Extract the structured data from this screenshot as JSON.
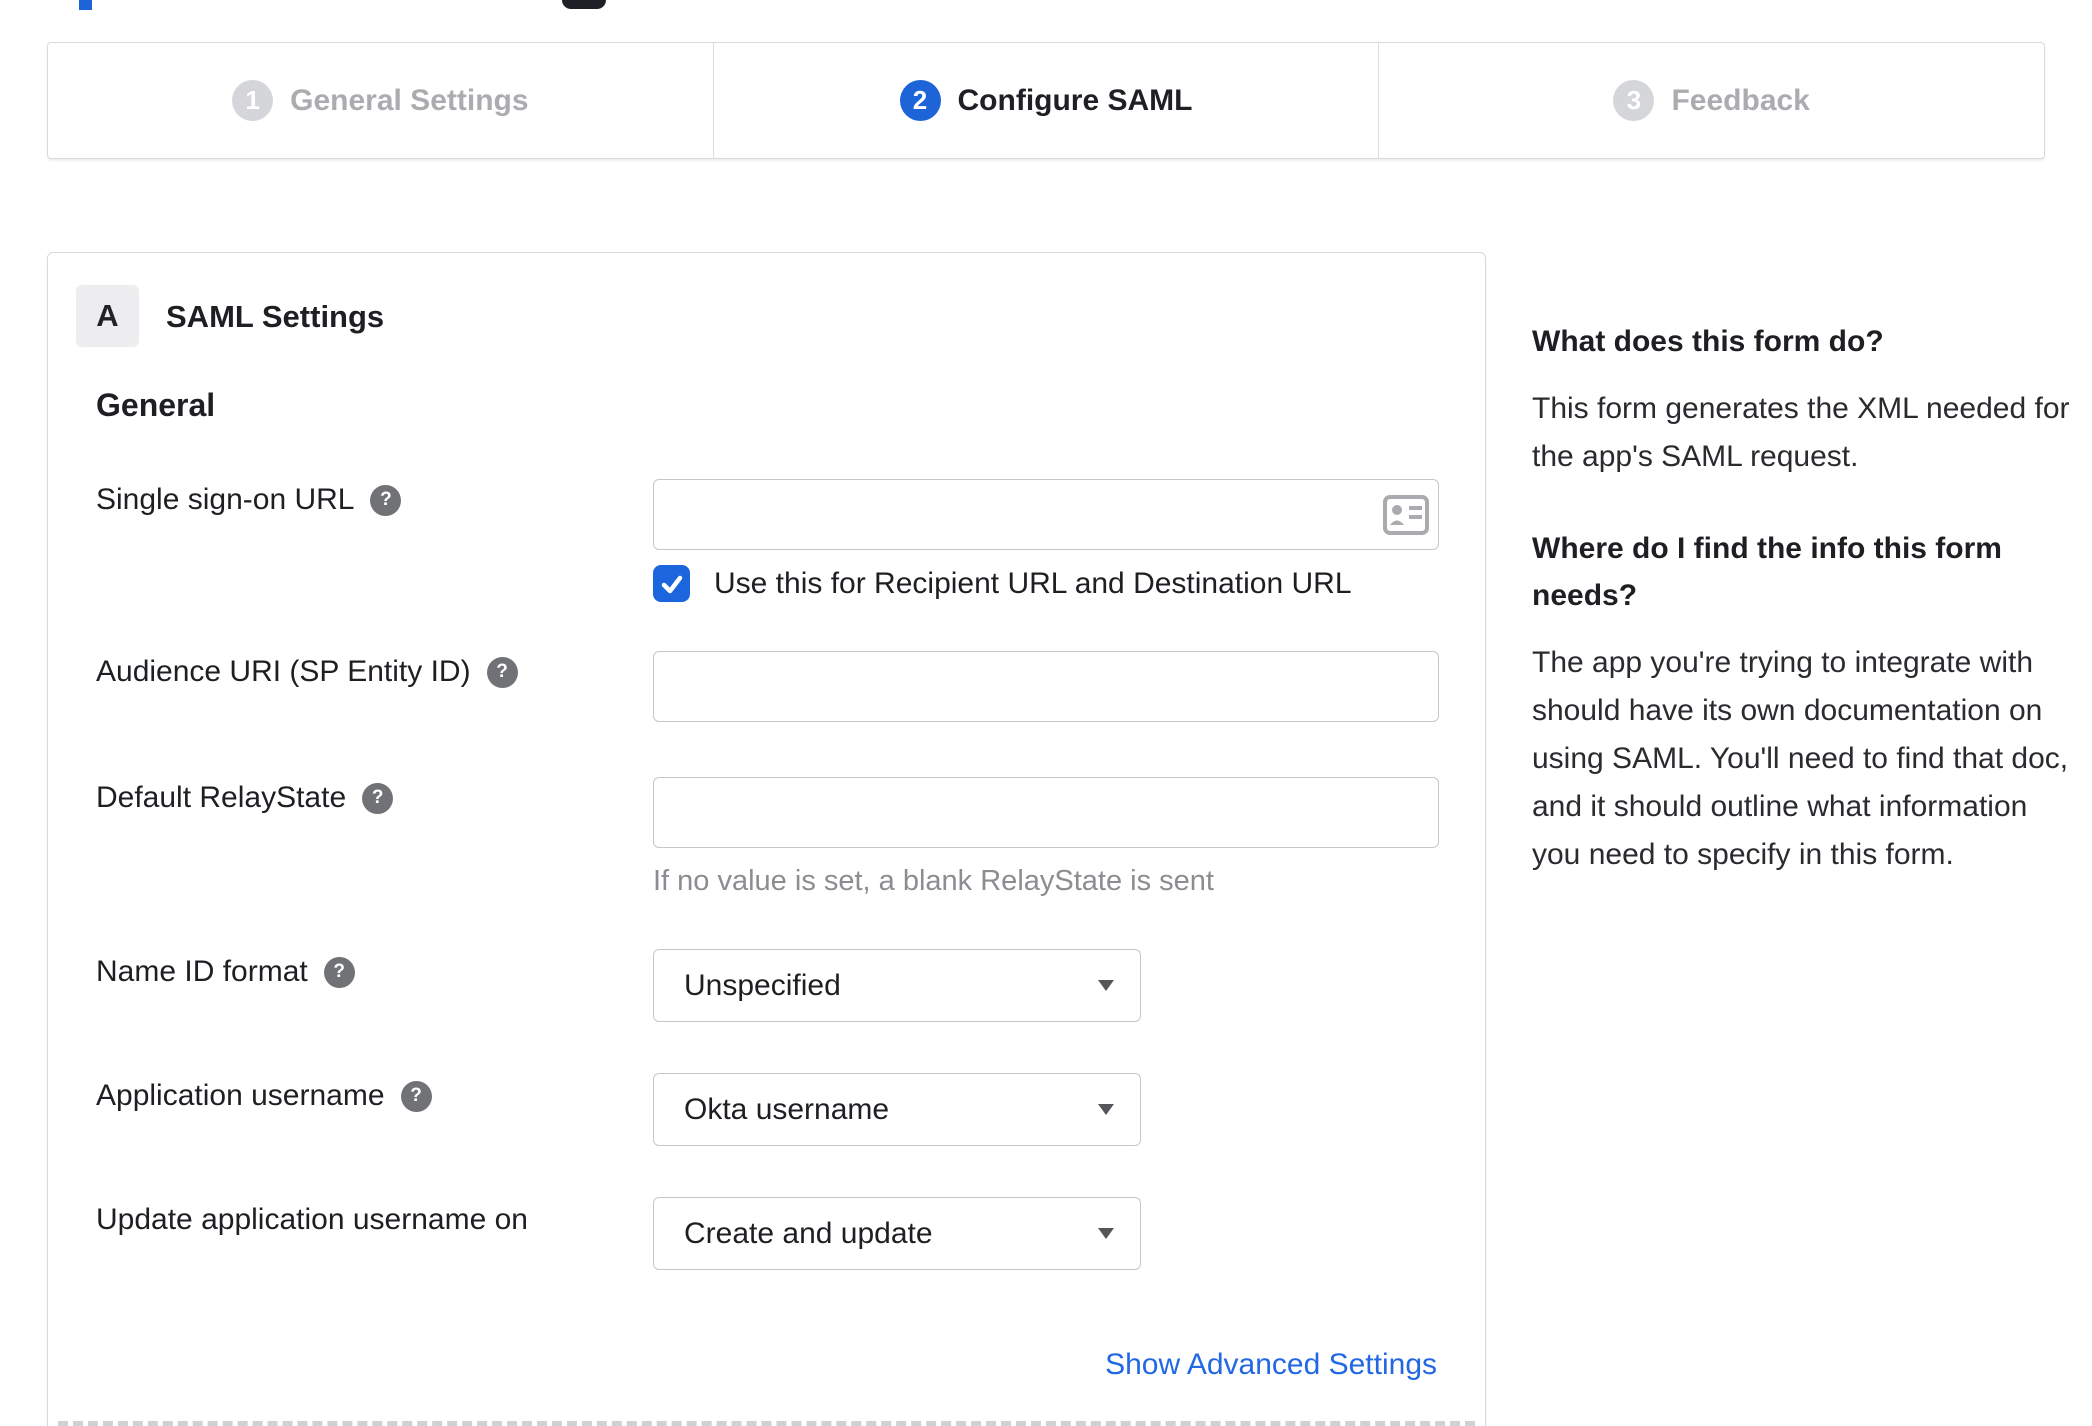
{
  "accent_color": "#1c64d8",
  "link_color": "#2268e3",
  "stepper": {
    "steps": [
      {
        "number": "1",
        "label": "General Settings",
        "state": "inactive"
      },
      {
        "number": "2",
        "label": "Configure SAML",
        "state": "active"
      },
      {
        "number": "3",
        "label": "Feedback",
        "state": "inactive"
      }
    ]
  },
  "panel": {
    "section_badge": "A",
    "section_title": "SAML Settings",
    "group_title": "General",
    "fields": {
      "sso": {
        "label": "Single sign-on URL",
        "value": "",
        "checkbox_label": "Use this for Recipient URL and Destination URL",
        "checked": true
      },
      "audience": {
        "label": "Audience URI (SP Entity ID)",
        "value": ""
      },
      "relay": {
        "label": "Default RelayState",
        "value": "",
        "helper": "If no value is set, a blank RelayState is sent"
      },
      "nameid": {
        "label": "Name ID format",
        "value": "Unspecified"
      },
      "appuser": {
        "label": "Application username",
        "value": "Okta username"
      },
      "update": {
        "label": "Update application username on",
        "value": "Create and update"
      }
    },
    "advanced_link": "Show Advanced Settings"
  },
  "sidebar": {
    "q1": "What does this form do?",
    "a1": "This form generates the XML needed for the app's SAML request.",
    "q2": "Where do I find the info this form needs?",
    "a2": "The app you're trying to integrate with should have its own documentation on using SAML. You'll need to find that doc, and it should outline what information you need to specify in this form."
  }
}
